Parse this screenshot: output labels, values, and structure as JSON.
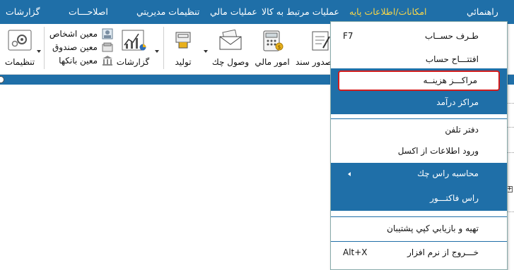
{
  "menubar": {
    "items": [
      {
        "label": "راهنمائي"
      },
      {
        "label": "امکانات/اطلاعات پایه",
        "active": true
      },
      {
        "label": "عمليات مرتبط به کالا"
      },
      {
        "label": "عمليات مالي"
      },
      {
        "label": "تنظيمات مديريتي"
      },
      {
        "label": "اصلاحـــات"
      },
      {
        "label": "گزارشات"
      }
    ]
  },
  "toolbar": {
    "settings": "تنظیمات",
    "reports": "گزارشات",
    "production": "تولید",
    "check_receipt": "وصول چك",
    "financial_affairs": "امور مالي",
    "document_issue": "صدور سند",
    "side_list": [
      "معین اشخاص",
      "معین صندوق",
      "معین بانکها"
    ]
  },
  "dropdown": {
    "items": [
      {
        "label": "طـرف حســاب",
        "shortcut": "F7"
      },
      {
        "label": "افتتـــاح حساب"
      },
      {
        "label": "مراکـــز هزینــه"
      },
      {
        "label": "مراكز درآمد"
      },
      {
        "label": "دفتر تلفن"
      },
      {
        "label": "ورود اطلاعات از اکسل"
      },
      {
        "label": "محاسبه راس چك"
      },
      {
        "label": "راس فاكتـــور"
      },
      {
        "label": "تهيه و بازيابي كپي پشتيبان"
      },
      {
        "label": "خـــروج از نرم افزار",
        "shortcut": "Alt+X"
      }
    ]
  },
  "colors": {
    "primary": "#1f6fa8",
    "active_menu": "#f7d64a",
    "highlight_border": "#d21c1c"
  }
}
